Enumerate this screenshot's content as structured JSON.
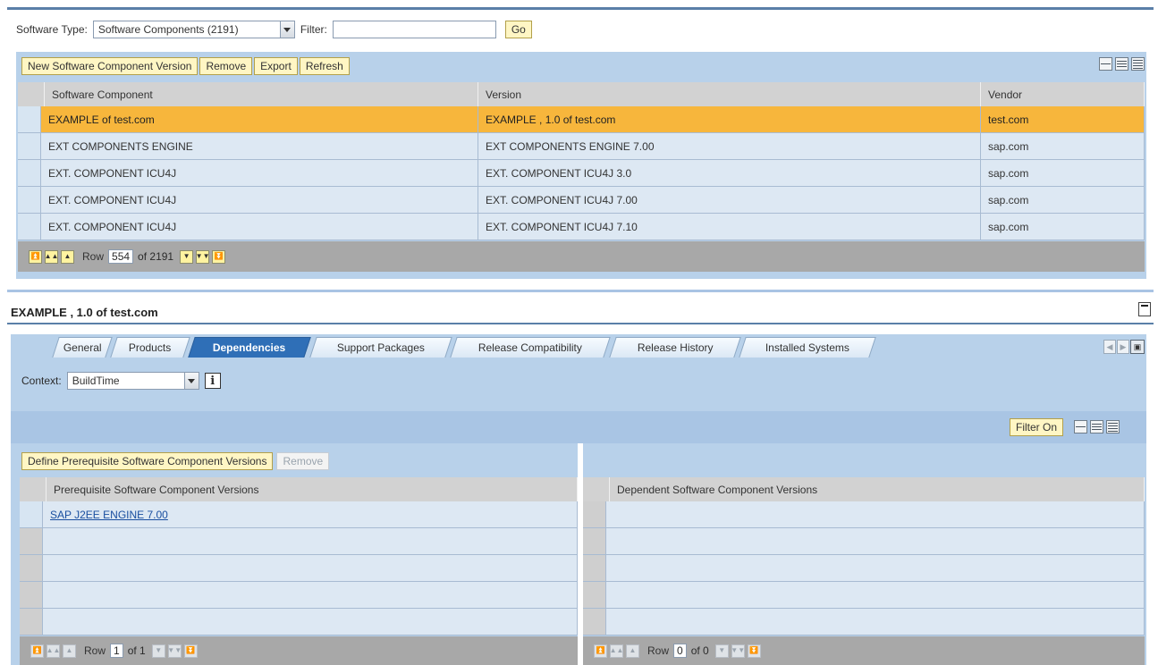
{
  "top_bar": {
    "software_type_label": "Software Type:",
    "software_type_value": "Software Components (2191)",
    "filter_label": "Filter:",
    "filter_value": "",
    "go_label": "Go"
  },
  "top_toolbar": {
    "new_label": "New Software Component Version",
    "remove_label": "Remove",
    "export_label": "Export",
    "refresh_label": "Refresh"
  },
  "top_table": {
    "columns": [
      "Software Component",
      "Version",
      "Vendor"
    ],
    "rows": [
      {
        "component": "EXAMPLE of test.com",
        "version": "EXAMPLE , 1.0 of test.com",
        "vendor": "test.com"
      },
      {
        "component": "EXT COMPONENTS ENGINE",
        "version": "EXT COMPONENTS ENGINE 7.00",
        "vendor": "sap.com"
      },
      {
        "component": "EXT. COMPONENT ICU4J",
        "version": "EXT. COMPONENT ICU4J 3.0",
        "vendor": "sap.com"
      },
      {
        "component": "EXT. COMPONENT ICU4J",
        "version": "EXT. COMPONENT ICU4J 7.00",
        "vendor": "sap.com"
      },
      {
        "component": "EXT. COMPONENT ICU4J",
        "version": "EXT. COMPONENT ICU4J 7.10",
        "vendor": "sap.com"
      }
    ],
    "pager": {
      "row_label": "Row",
      "current": "554",
      "of_text": "of 2191"
    }
  },
  "detail": {
    "title": "EXAMPLE , 1.0 of test.com",
    "tabs": [
      "General",
      "Products",
      "Dependencies",
      "Support Packages",
      "Release Compatibility",
      "Release History",
      "Installed Systems"
    ],
    "active_tab": "Dependencies",
    "context_label": "Context:",
    "context_value": "BuildTime",
    "filter_on_label": "Filter On",
    "define_label": "Define Prerequisite Software Component Versions",
    "remove_label": "Remove",
    "left_table": {
      "header": "Prerequisite Software Component Versions",
      "rows": [
        "SAP J2EE ENGINE 7.00",
        "",
        "",
        "",
        ""
      ],
      "pager": {
        "row_label": "Row",
        "current": "1",
        "of_text": "of 1"
      }
    },
    "right_table": {
      "header": "Dependent Software Component Versions",
      "rows": [
        "",
        "",
        "",
        "",
        ""
      ],
      "pager": {
        "row_label": "Row",
        "current": "0",
        "of_text": "of 0"
      }
    }
  }
}
